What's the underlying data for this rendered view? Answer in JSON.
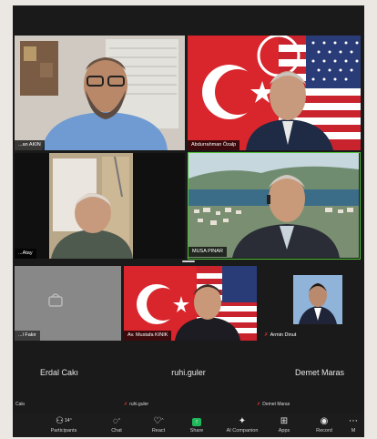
{
  "participants": [
    {
      "name": "...an AKIN",
      "muted": false
    },
    {
      "name": "Abdurrahman Özalp",
      "muted": false
    },
    {
      "name": "...Atay",
      "muted": false
    },
    {
      "name": "MUSA PINAR",
      "muted": false
    },
    {
      "name": "...l Fakir",
      "muted": false
    },
    {
      "name": "Av. Mustafa KINIK",
      "muted": false
    },
    {
      "name": "Armin Dinut",
      "muted": true
    }
  ],
  "audio_only": [
    {
      "display_name": "Erdal Cakı",
      "label": "Cakı",
      "muted": false
    },
    {
      "display_name": "ruhi.guler",
      "label": "ruhi.guler",
      "muted": true
    },
    {
      "display_name": "Demet Maras",
      "label": "Demet Maras",
      "muted": true
    }
  ],
  "toolbar": {
    "participants_label": "Participants",
    "participants_count": "14",
    "chat_label": "Chat",
    "react_label": "React",
    "share_label": "Share",
    "ai_label": "AI Companion",
    "apps_label": "Apps",
    "record_label": "Record",
    "more_label": "M"
  },
  "colors": {
    "share_green": "#1fb85a",
    "mute_red": "#e0362c",
    "active_speaker": "#4fbf3a"
  },
  "icons": [
    "participants-icon",
    "chat-icon",
    "react-icon",
    "share-icon",
    "ai-companion-icon",
    "apps-icon",
    "record-icon"
  ]
}
